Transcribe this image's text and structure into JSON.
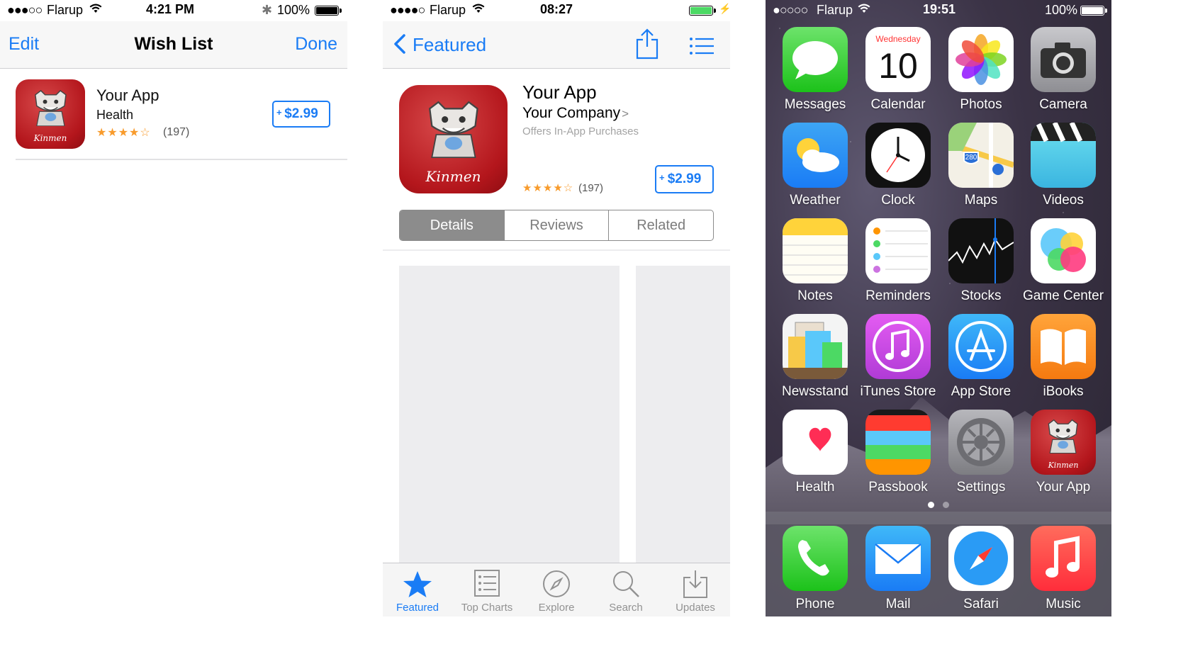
{
  "wishlist": {
    "status": {
      "carrier": "Flarup",
      "time": "4:21 PM",
      "battery": "100%",
      "signal_dots": "●●●○○"
    },
    "nav": {
      "edit": "Edit",
      "title": "Wish List",
      "done": "Done"
    },
    "item": {
      "name": "Your App",
      "category": "Health",
      "stars": "★★★★☆",
      "rating_count": "(197)",
      "price": "$2.99",
      "icon_text": "Kinmen"
    }
  },
  "detail": {
    "status": {
      "carrier": "Flarup",
      "time": "08:27",
      "signal_dots": "●●●●○"
    },
    "nav": {
      "back": "Featured"
    },
    "app": {
      "name": "Your App",
      "company": "Your Company",
      "company_chevron": ">",
      "iap": "Offers In-App Purchases",
      "stars": "★★★★☆",
      "rating_count": "(197)",
      "price": "$2.99",
      "icon_text": "Kinmen"
    },
    "segments": [
      "Details",
      "Reviews",
      "Related"
    ],
    "tabs": [
      "Featured",
      "Top Charts",
      "Explore",
      "Search",
      "Updates"
    ]
  },
  "home": {
    "status": {
      "carrier": "Flarup",
      "time": "19:51",
      "battery": "100%",
      "signal_dots": "●○○○○"
    },
    "calendar": {
      "weekday": "Wednesday",
      "day": "10"
    },
    "maps_shield": "280",
    "apps": [
      "Messages",
      "Calendar",
      "Photos",
      "Camera",
      "Weather",
      "Clock",
      "Maps",
      "Videos",
      "Notes",
      "Reminders",
      "Stocks",
      "Game Center",
      "Newsstand",
      "iTunes Store",
      "App Store",
      "iBooks",
      "Health",
      "Passbook",
      "Settings",
      "Your App"
    ],
    "dock": [
      "Phone",
      "Mail",
      "Safari",
      "Music"
    ],
    "your_app_icon_text": "Kinmen"
  },
  "colors": {
    "ios_blue": "#1a7cf5",
    "star_orange": "#f89b2c",
    "app_red": "#b4161c"
  }
}
